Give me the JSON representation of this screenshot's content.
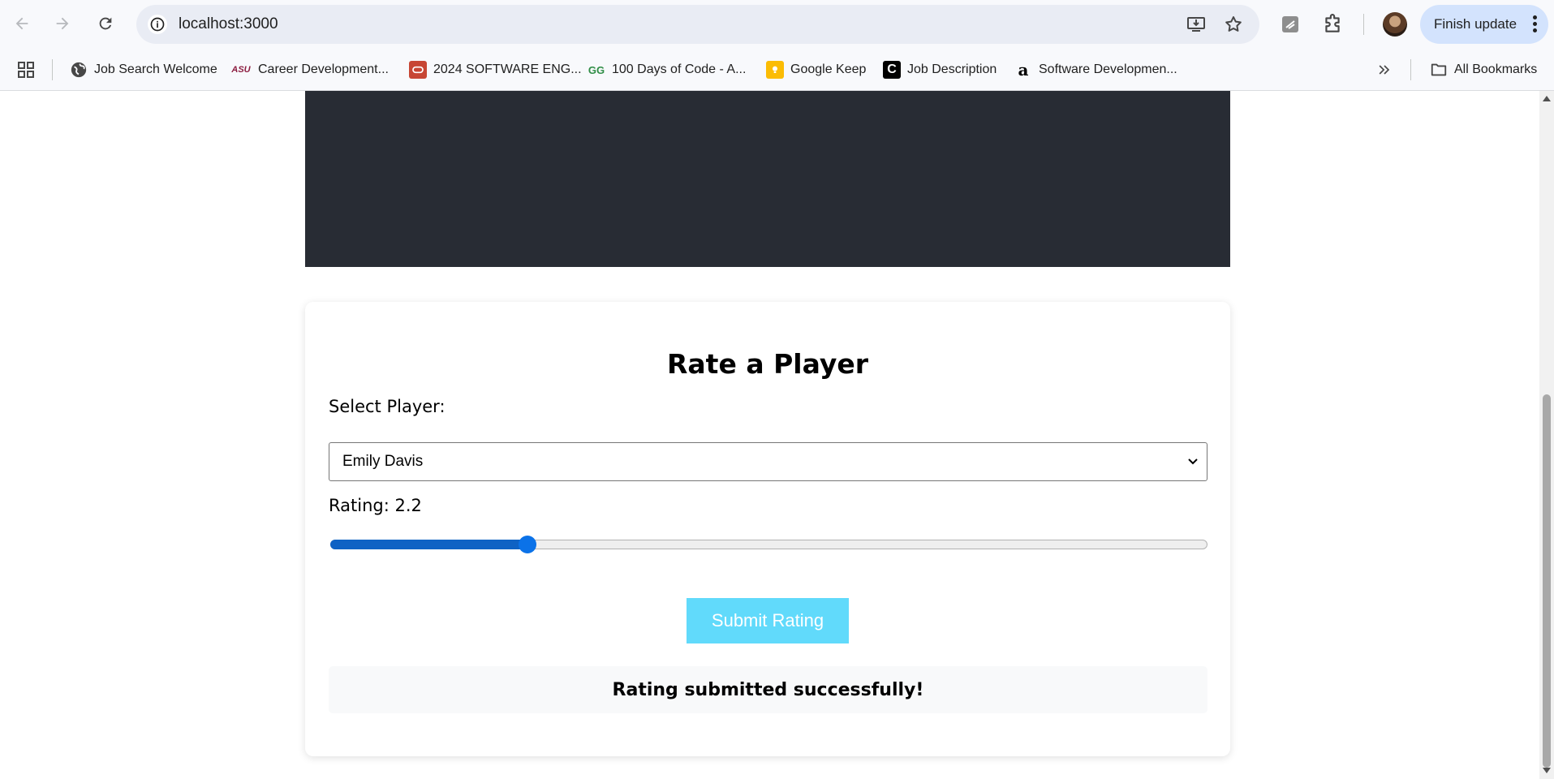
{
  "browser": {
    "url": "localhost:3000",
    "finish_update_label": "Finish update",
    "bookmarks": [
      {
        "label": "Job Search Welcome",
        "icon": "globe-icon"
      },
      {
        "label": "Career Development...",
        "icon": "asu-logo-icon",
        "badge": "ASU"
      },
      {
        "label": "2024 SOFTWARE ENG...",
        "icon": "oracle-icon"
      },
      {
        "label": "100 Days of Code - A...",
        "icon": "geeksforgeeks-icon",
        "badge": "GG"
      },
      {
        "label": "Google Keep",
        "icon": "keep-icon"
      },
      {
        "label": "Job Description",
        "icon": "c-logo-icon",
        "badge": "C"
      },
      {
        "label": "Software Developmen...",
        "icon": "amazon-icon",
        "badge": "a"
      }
    ],
    "all_bookmarks_label": "All Bookmarks"
  },
  "page": {
    "form_title": "Rate a Player",
    "select_label": "Select Player:",
    "selected_player": "Emily Davis",
    "rating_label": "Rating: 2.2",
    "rating_value": 2.2,
    "rating_min": 0,
    "rating_max": 10,
    "submit_label": "Submit Rating",
    "success_message": "Rating submitted successfully!"
  },
  "colors": {
    "header_bg": "#282c34",
    "submit_bg": "#61dafb",
    "slider_accent": "#0b72e8",
    "update_bg": "#d3e3fd"
  }
}
